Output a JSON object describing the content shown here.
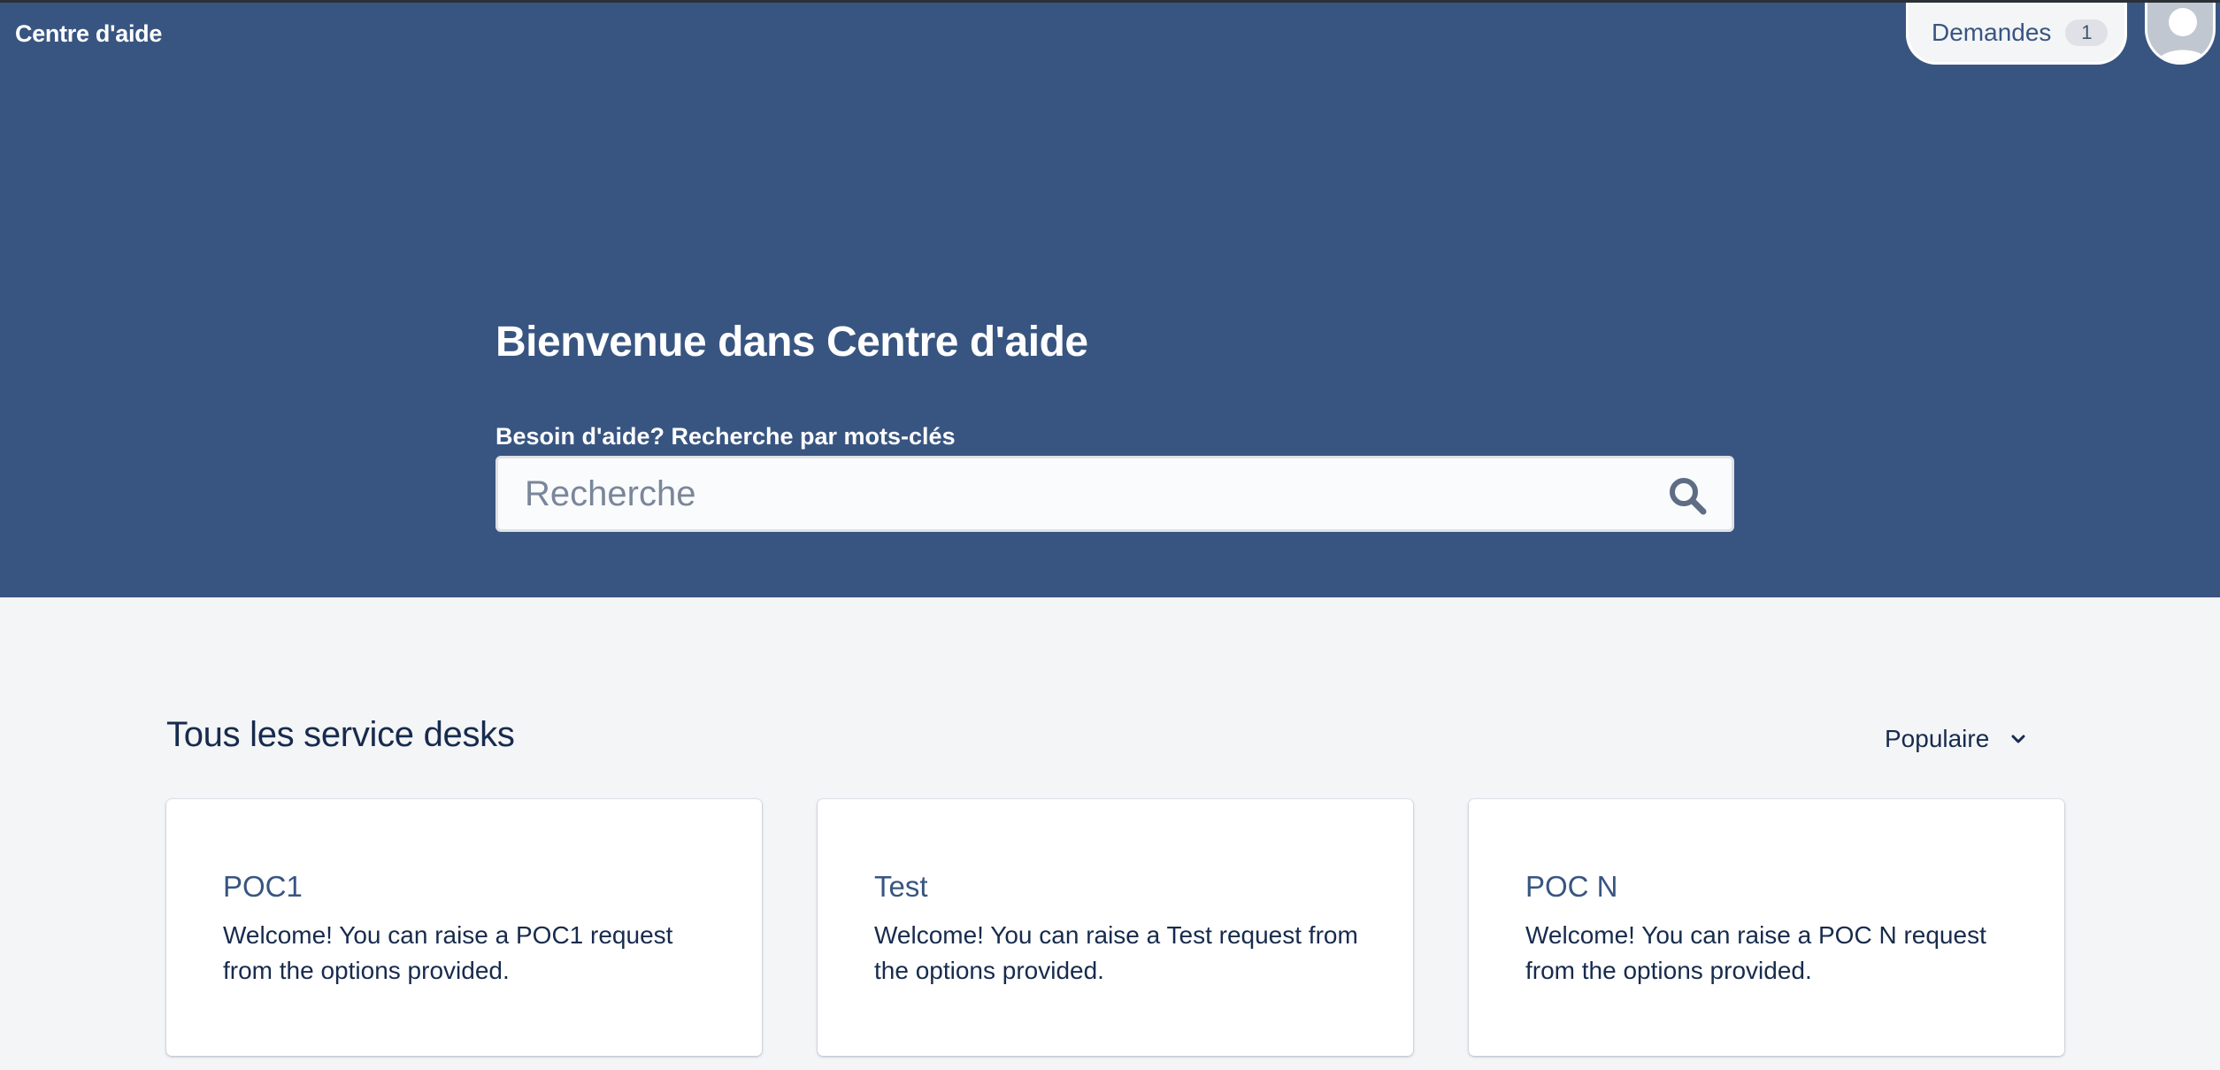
{
  "header": {
    "brand": "Centre d'aide",
    "requests_label": "Demandes",
    "requests_count": "1",
    "avatar_icon": "user-avatar-icon"
  },
  "hero": {
    "title": "Bienvenue dans Centre d'aide",
    "search_label": "Besoin d'aide? Recherche par mots-clés",
    "search_placeholder": "Recherche",
    "search_value": "",
    "search_icon": "search-icon"
  },
  "desks": {
    "title": "Tous les service desks",
    "sort_value": "Populaire",
    "sort_icon": "chevron-down-icon",
    "cards": [
      {
        "title": "POC1",
        "description": "Welcome! You can raise a POC1 request from the options provided."
      },
      {
        "title": "Test",
        "description": "Welcome! You can raise a Test request from the options provided."
      },
      {
        "title": "POC N",
        "description": "Welcome! You can raise a POC N request from the options provided."
      }
    ]
  },
  "colors": {
    "hero_background": "#385581",
    "page_background": "#f4f5f7",
    "card_title": "#385581",
    "text_primary": "#172b4d"
  }
}
